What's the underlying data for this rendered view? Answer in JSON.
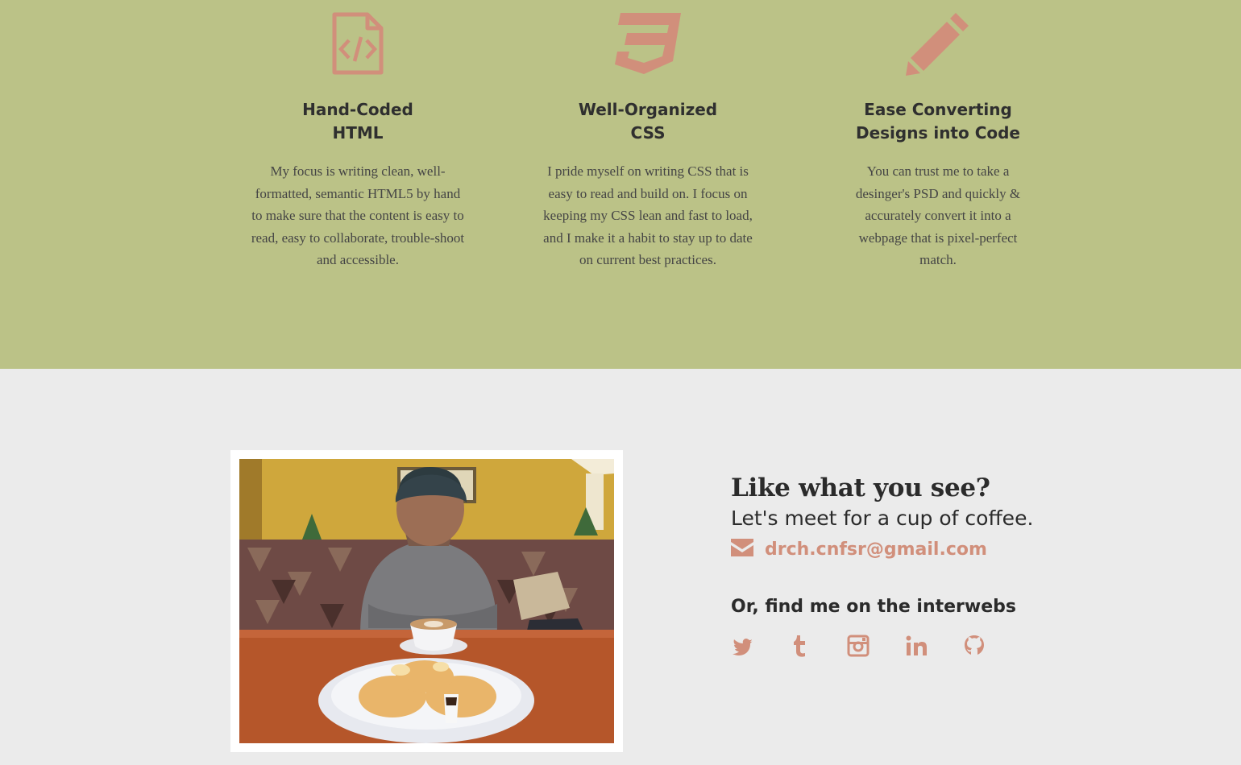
{
  "skills": [
    {
      "icon": "html-file-icon",
      "title": "Hand-Coded\nHTML",
      "description": "My focus is writing clean, well-formatted, semantic HTML5 by hand to make sure that the content is easy to read, easy to collaborate, trouble-shoot and accessible."
    },
    {
      "icon": "css3-icon",
      "title": "Well-Organized\nCSS",
      "description": "I pride myself on writing CSS that is easy to read and build on. I focus on keeping my CSS lean and fast to load, and I make it a habit to stay up to date on current best practices."
    },
    {
      "icon": "pencil-icon",
      "title": "Ease Converting\nDesigns into Code",
      "description": "You can trust me to take a desinger's PSD and quickly & accurately convert it into a webpage that is pixel-perfect match."
    }
  ],
  "contact": {
    "heading": "Like what you see?",
    "subheading": "Let's meet for a cup of coffee.",
    "email": "drch.cnfsr@gmail.com",
    "social_heading": "Or, find me on the interwebs",
    "socials": [
      "twitter-icon",
      "tumblr-icon",
      "instagram-icon",
      "linkedin-icon",
      "github-icon"
    ]
  },
  "colors": {
    "skills_bg": "#bbc287",
    "accent": "#d18f7b",
    "page_bg": "#ebebeb",
    "text": "#2b2b2b"
  }
}
